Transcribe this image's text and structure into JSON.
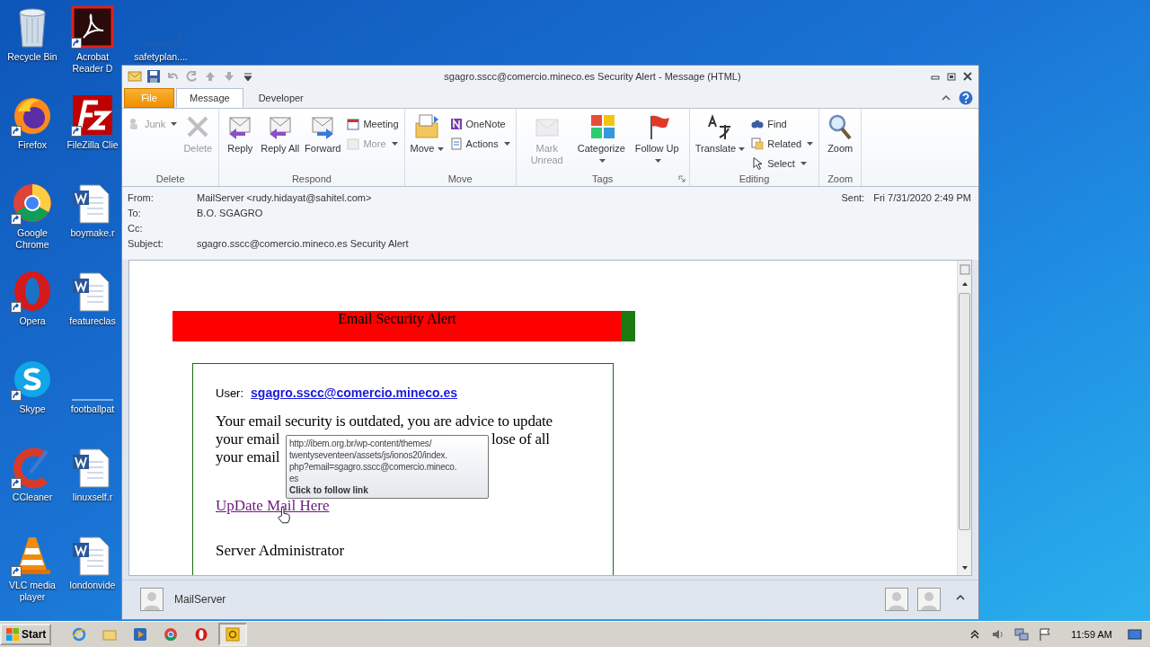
{
  "desktop_icons": [
    {
      "label": "Recycle Bin",
      "kind": "bin",
      "shortcut": false
    },
    {
      "label": "Firefox",
      "kind": "firefox",
      "shortcut": true
    },
    {
      "label": "Google Chrome",
      "kind": "chrome",
      "shortcut": true
    },
    {
      "label": "Opera",
      "kind": "opera",
      "shortcut": true
    },
    {
      "label": "Skype",
      "kind": "skype",
      "shortcut": true
    },
    {
      "label": "CCleaner",
      "kind": "ccleaner",
      "shortcut": true
    },
    {
      "label": "VLC media player",
      "kind": "vlc",
      "shortcut": true
    },
    {
      "label": "Acrobat Reader D",
      "kind": "acrobat",
      "shortcut": true
    },
    {
      "label": "FileZilla Clie",
      "kind": "filezilla",
      "shortcut": true
    },
    {
      "label": "boymake.r",
      "kind": "document",
      "shortcut": false
    },
    {
      "label": "featureclas",
      "kind": "document",
      "shortcut": false
    },
    {
      "label": "footballpat",
      "kind": "blank",
      "shortcut": false
    },
    {
      "label": "linuxself.r",
      "kind": "document",
      "shortcut": false
    },
    {
      "label": "londonvide",
      "kind": "document",
      "shortcut": false
    },
    {
      "label": "safetyplan....",
      "kind": "bar",
      "shortcut": false
    }
  ],
  "window": {
    "title": "sgagro.sscc@comercio.mineco.es Security Alert  -  Message (HTML)"
  },
  "tabs": [
    {
      "label": "File",
      "kind": "file",
      "selected": false
    },
    {
      "label": "Message",
      "kind": "tab",
      "selected": true
    },
    {
      "label": "Developer",
      "kind": "tab",
      "selected": false
    }
  ],
  "ribbon": {
    "groups": [
      {
        "label": "Delete",
        "launcher": false,
        "buttons": [
          {
            "label": "Junk",
            "kind": "small",
            "disabled": true,
            "dropdown": true
          },
          {
            "label": "Delete",
            "kind": "large",
            "disabled": true,
            "dropdown": false
          }
        ]
      },
      {
        "label": "Respond",
        "launcher": false,
        "buttons": [
          {
            "label": "Reply",
            "kind": "large",
            "disabled": false,
            "dropdown": false
          },
          {
            "label": "Reply All",
            "kind": "large",
            "disabled": false,
            "dropdown": false
          },
          {
            "label": "Forward",
            "kind": "large",
            "disabled": false,
            "dropdown": false
          },
          {
            "label": "Meeting",
            "kind": "small",
            "disabled": false,
            "dropdown": false
          },
          {
            "label": "More",
            "kind": "small",
            "disabled": true,
            "dropdown": true
          }
        ]
      },
      {
        "label": "Move",
        "launcher": false,
        "buttons": [
          {
            "label": "Move",
            "kind": "large",
            "disabled": false,
            "dropdown": true
          },
          {
            "label": "OneNote",
            "kind": "small",
            "disabled": false,
            "dropdown": false
          },
          {
            "label": "Actions",
            "kind": "small",
            "disabled": false,
            "dropdown": true
          }
        ]
      },
      {
        "label": "Tags",
        "launcher": true,
        "buttons": [
          {
            "label": "Mark Unread",
            "kind": "large",
            "disabled": true,
            "dropdown": false
          },
          {
            "label": "Categorize",
            "kind": "large",
            "disabled": false,
            "dropdown": true
          },
          {
            "label": "Follow Up",
            "kind": "large",
            "disabled": false,
            "dropdown": true
          }
        ]
      },
      {
        "label": "Editing",
        "launcher": false,
        "buttons": [
          {
            "label": "Translate",
            "kind": "large",
            "disabled": false,
            "dropdown": true
          },
          {
            "label": "Find",
            "kind": "small",
            "disabled": false,
            "dropdown": false
          },
          {
            "label": "Related",
            "kind": "small",
            "disabled": false,
            "dropdown": true
          },
          {
            "label": "Select",
            "kind": "small",
            "disabled": false,
            "dropdown": true
          }
        ]
      },
      {
        "label": "Zoom",
        "launcher": false,
        "buttons": [
          {
            "label": "Zoom",
            "kind": "large",
            "disabled": false,
            "dropdown": false
          }
        ]
      }
    ]
  },
  "header": {
    "fields": [
      {
        "label": "From:",
        "value": "MailServer <rudy.hidayat@sahitel.com>"
      },
      {
        "label": "To:",
        "value": "B.O. SGAGRO"
      },
      {
        "label": "Cc:"
      },
      {
        "label": "Subject:",
        "value": "sgagro.sscc@comercio.mineco.es Security Alert"
      }
    ],
    "sent": {
      "label": "Sent:",
      "value": "Fri 7/31/2020 2:49 PM"
    }
  },
  "message": {
    "banner": "Email Security Alert",
    "user_label": "User:",
    "user_link": "sgagro.sscc@comercio.mineco.es",
    "line_1": "Your email security is outdated, you are advice to update",
    "line_2_start": "your email",
    "line_2_end": "lose of all",
    "line_3_start": "your email",
    "update_link": "UpDate Mail Here",
    "signature": "Server Administrator",
    "tooltip": {
      "url_lines": [
        "http://ibem.org.br/wp-content/themes/",
        "twentyseventeen/assets/js/ionos20/index.",
        "php?email=sgagro.sscc@comercio.mineco.",
        "es"
      ],
      "hint": "Click to follow link"
    }
  },
  "people_pane": {
    "name": "MailServer"
  },
  "taskbar": {
    "start": "Start",
    "apps": [
      {
        "kind": "ie",
        "selected": false
      },
      {
        "kind": "folder",
        "selected": false
      },
      {
        "kind": "media",
        "selected": false
      },
      {
        "kind": "chrome",
        "selected": false
      },
      {
        "kind": "opera",
        "selected": false
      },
      {
        "kind": "outlook",
        "selected": true
      }
    ],
    "clock": "11:59 AM"
  }
}
